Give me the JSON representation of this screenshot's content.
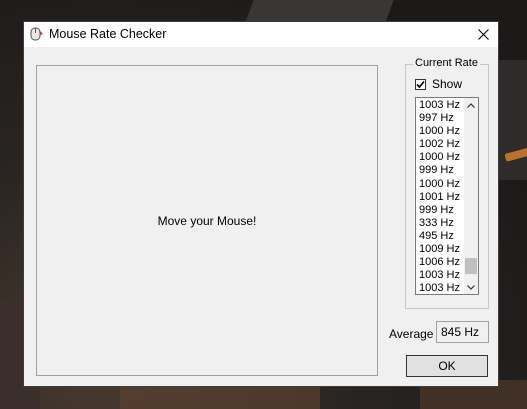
{
  "window": {
    "title": "Mouse Rate Checker"
  },
  "mouse_area": {
    "prompt": "Move your Mouse!"
  },
  "rate_group": {
    "label": "Current Rate",
    "show_label": "Show",
    "show_checked": true,
    "rates": [
      "1003 Hz",
      "997 Hz",
      "1000 Hz",
      "1002 Hz",
      "1000 Hz",
      "999 Hz",
      "1000 Hz",
      "1001 Hz",
      "999 Hz",
      "333 Hz",
      "495 Hz",
      "1009 Hz",
      "1006 Hz",
      "1003 Hz",
      "1003 Hz"
    ]
  },
  "average": {
    "label": "Average",
    "value": "845 Hz"
  },
  "buttons": {
    "ok_label": "OK"
  },
  "icons": {
    "app": "mouse-app-icon",
    "close": "close-icon",
    "check": "checkmark-icon",
    "scroll_up": "scroll-up-arrow-icon",
    "scroll_down": "scroll-down-arrow-icon"
  }
}
